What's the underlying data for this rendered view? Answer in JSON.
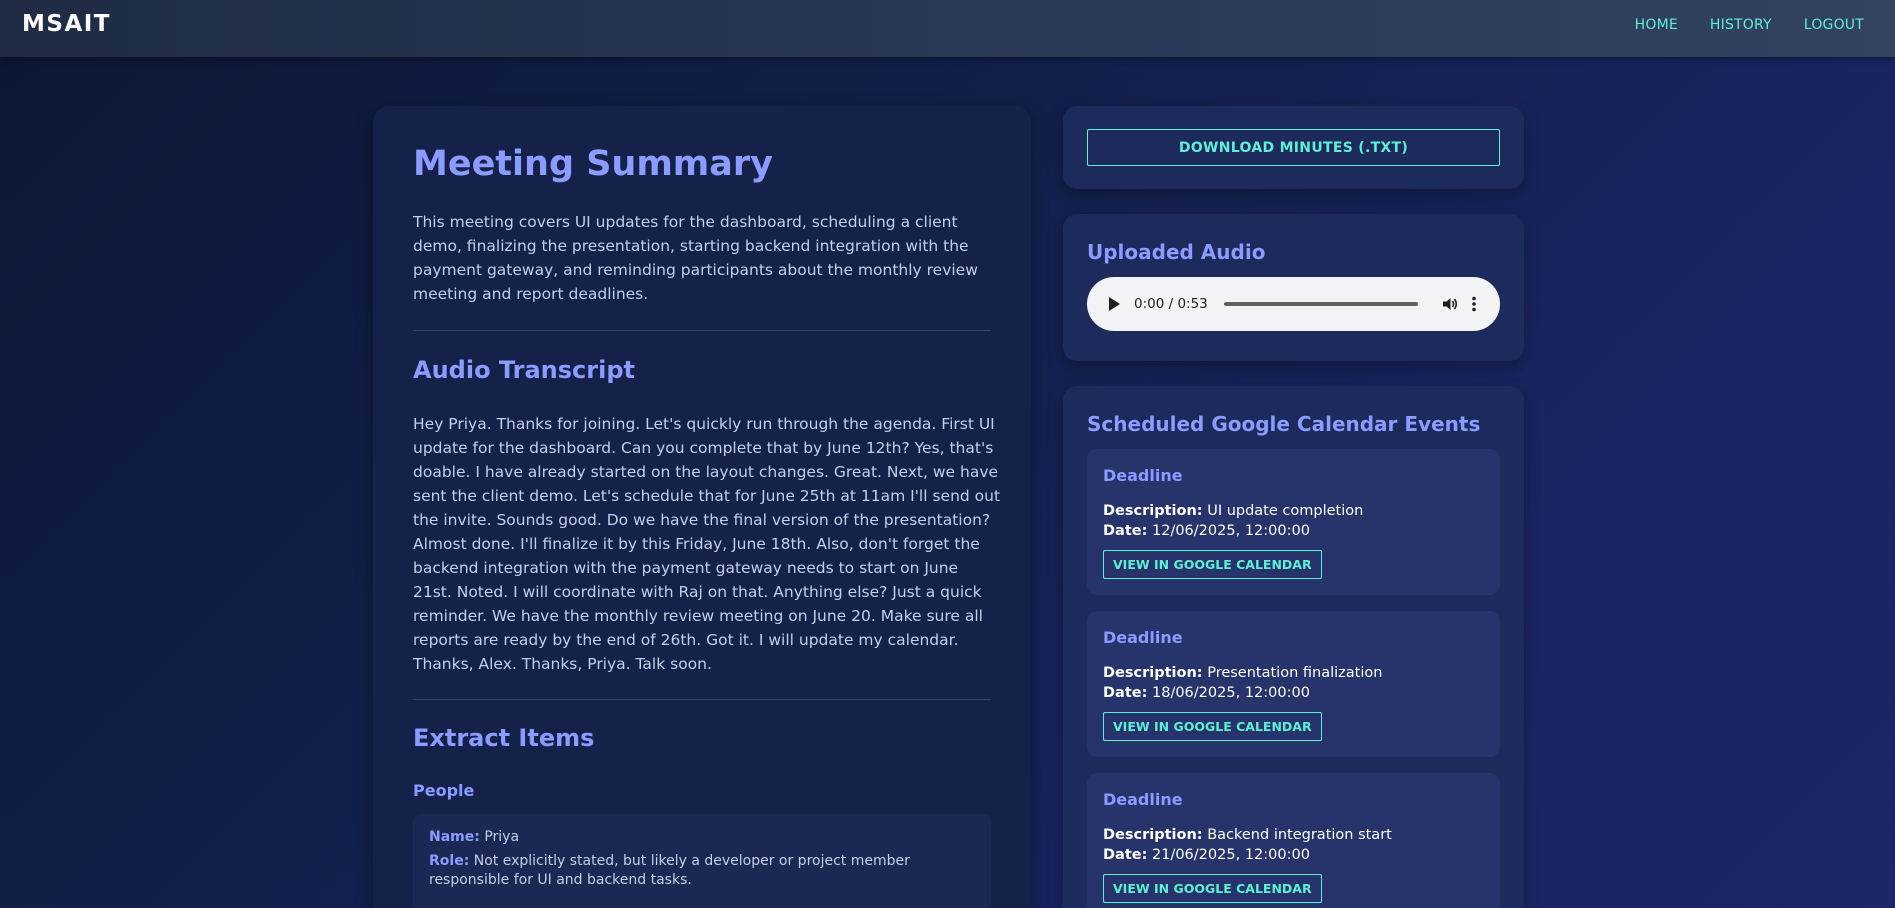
{
  "navbar": {
    "brand": "MSAIT",
    "links": [
      "HOME",
      "HISTORY",
      "LOGOUT"
    ]
  },
  "summary": {
    "title": "Meeting Summary",
    "text": "This meeting covers UI updates for the dashboard, scheduling a client demo, finalizing the presentation, starting backend integration with the payment gateway, and reminding participants about the monthly review meeting and report deadlines."
  },
  "transcript": {
    "title": "Audio Transcript",
    "text": "Hey Priya. Thanks for joining. Let's quickly run through the agenda. First UI update for the dashboard. Can you complete that by June 12th? Yes, that's doable. I have already started on the layout changes. Great. Next, we have sent the client demo. Let's schedule that for June 25th at 11am I'll send out the invite. Sounds good. Do we have the final version of the presentation? Almost done. I'll finalize it by this Friday, June 18th. Also, don't forget the backend integration with the payment gateway needs to start on June 21st. Noted. I will coordinate with Raj on that. Anything else? Just a quick reminder. We have the monthly review meeting on June 20. Make sure all reports are ready by the end of 26th. Got it. I will update my calendar. Thanks, Alex. Thanks, Priya. Talk soon."
  },
  "extract": {
    "title": "Extract Items",
    "people_title": "People",
    "people": [
      {
        "name_label": "Name:",
        "name": "Priya",
        "role_label": "Role:",
        "role": "Not explicitly stated, but likely a developer or project member responsible for UI and backend tasks."
      }
    ]
  },
  "download": {
    "label": "DOWNLOAD MINUTES (.TXT)"
  },
  "audio": {
    "title": "Uploaded Audio",
    "time": "0:00 / 0:53",
    "progress": 0
  },
  "calendar": {
    "title": "Scheduled Google Calendar Events",
    "events": [
      {
        "title": "Deadline",
        "desc_label": "Description:",
        "description": "UI update completion",
        "date_label": "Date:",
        "date": "12/06/2025, 12:00:00",
        "button": "VIEW IN GOOGLE CALENDAR"
      },
      {
        "title": "Deadline",
        "desc_label": "Description:",
        "description": "Presentation finalization",
        "date_label": "Date:",
        "date": "18/06/2025, 12:00:00",
        "button": "VIEW IN GOOGLE CALENDAR"
      },
      {
        "title": "Deadline",
        "desc_label": "Description:",
        "description": "Backend integration start",
        "date_label": "Date:",
        "date": "21/06/2025, 12:00:00",
        "button": "VIEW IN GOOGLE CALENDAR"
      }
    ]
  },
  "colors": {
    "accent": "#8c9bff",
    "link": "#5ef0d6",
    "background": "#131f4a"
  }
}
